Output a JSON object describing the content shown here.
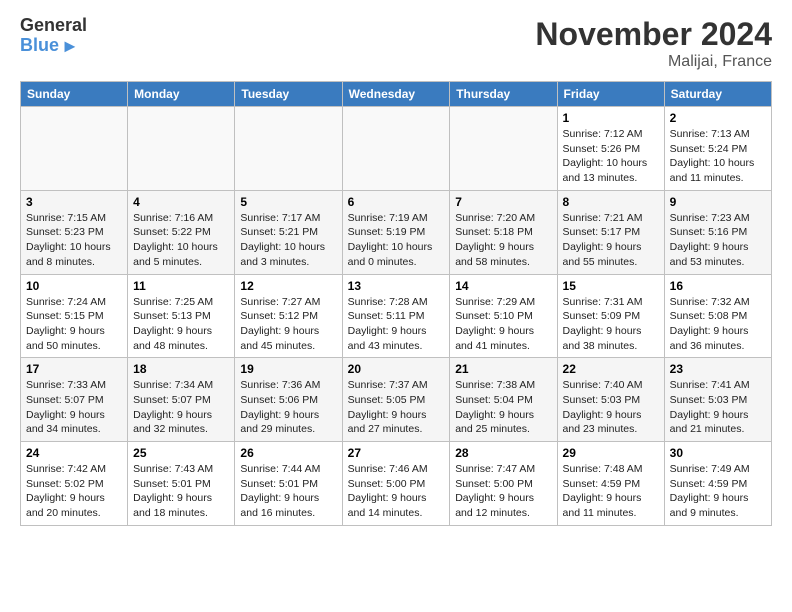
{
  "logo": {
    "general": "General",
    "blue": "Blue"
  },
  "title": "November 2024",
  "subtitle": "Malijai, France",
  "headers": [
    "Sunday",
    "Monday",
    "Tuesday",
    "Wednesday",
    "Thursday",
    "Friday",
    "Saturday"
  ],
  "weeks": [
    [
      {
        "day": "",
        "info": ""
      },
      {
        "day": "",
        "info": ""
      },
      {
        "day": "",
        "info": ""
      },
      {
        "day": "",
        "info": ""
      },
      {
        "day": "",
        "info": ""
      },
      {
        "day": "1",
        "info": "Sunrise: 7:12 AM\nSunset: 5:26 PM\nDaylight: 10 hours\nand 13 minutes."
      },
      {
        "day": "2",
        "info": "Sunrise: 7:13 AM\nSunset: 5:24 PM\nDaylight: 10 hours\nand 11 minutes."
      }
    ],
    [
      {
        "day": "3",
        "info": "Sunrise: 7:15 AM\nSunset: 5:23 PM\nDaylight: 10 hours\nand 8 minutes."
      },
      {
        "day": "4",
        "info": "Sunrise: 7:16 AM\nSunset: 5:22 PM\nDaylight: 10 hours\nand 5 minutes."
      },
      {
        "day": "5",
        "info": "Sunrise: 7:17 AM\nSunset: 5:21 PM\nDaylight: 10 hours\nand 3 minutes."
      },
      {
        "day": "6",
        "info": "Sunrise: 7:19 AM\nSunset: 5:19 PM\nDaylight: 10 hours\nand 0 minutes."
      },
      {
        "day": "7",
        "info": "Sunrise: 7:20 AM\nSunset: 5:18 PM\nDaylight: 9 hours\nand 58 minutes."
      },
      {
        "day": "8",
        "info": "Sunrise: 7:21 AM\nSunset: 5:17 PM\nDaylight: 9 hours\nand 55 minutes."
      },
      {
        "day": "9",
        "info": "Sunrise: 7:23 AM\nSunset: 5:16 PM\nDaylight: 9 hours\nand 53 minutes."
      }
    ],
    [
      {
        "day": "10",
        "info": "Sunrise: 7:24 AM\nSunset: 5:15 PM\nDaylight: 9 hours\nand 50 minutes."
      },
      {
        "day": "11",
        "info": "Sunrise: 7:25 AM\nSunset: 5:13 PM\nDaylight: 9 hours\nand 48 minutes."
      },
      {
        "day": "12",
        "info": "Sunrise: 7:27 AM\nSunset: 5:12 PM\nDaylight: 9 hours\nand 45 minutes."
      },
      {
        "day": "13",
        "info": "Sunrise: 7:28 AM\nSunset: 5:11 PM\nDaylight: 9 hours\nand 43 minutes."
      },
      {
        "day": "14",
        "info": "Sunrise: 7:29 AM\nSunset: 5:10 PM\nDaylight: 9 hours\nand 41 minutes."
      },
      {
        "day": "15",
        "info": "Sunrise: 7:31 AM\nSunset: 5:09 PM\nDaylight: 9 hours\nand 38 minutes."
      },
      {
        "day": "16",
        "info": "Sunrise: 7:32 AM\nSunset: 5:08 PM\nDaylight: 9 hours\nand 36 minutes."
      }
    ],
    [
      {
        "day": "17",
        "info": "Sunrise: 7:33 AM\nSunset: 5:07 PM\nDaylight: 9 hours\nand 34 minutes."
      },
      {
        "day": "18",
        "info": "Sunrise: 7:34 AM\nSunset: 5:07 PM\nDaylight: 9 hours\nand 32 minutes."
      },
      {
        "day": "19",
        "info": "Sunrise: 7:36 AM\nSunset: 5:06 PM\nDaylight: 9 hours\nand 29 minutes."
      },
      {
        "day": "20",
        "info": "Sunrise: 7:37 AM\nSunset: 5:05 PM\nDaylight: 9 hours\nand 27 minutes."
      },
      {
        "day": "21",
        "info": "Sunrise: 7:38 AM\nSunset: 5:04 PM\nDaylight: 9 hours\nand 25 minutes."
      },
      {
        "day": "22",
        "info": "Sunrise: 7:40 AM\nSunset: 5:03 PM\nDaylight: 9 hours\nand 23 minutes."
      },
      {
        "day": "23",
        "info": "Sunrise: 7:41 AM\nSunset: 5:03 PM\nDaylight: 9 hours\nand 21 minutes."
      }
    ],
    [
      {
        "day": "24",
        "info": "Sunrise: 7:42 AM\nSunset: 5:02 PM\nDaylight: 9 hours\nand 20 minutes."
      },
      {
        "day": "25",
        "info": "Sunrise: 7:43 AM\nSunset: 5:01 PM\nDaylight: 9 hours\nand 18 minutes."
      },
      {
        "day": "26",
        "info": "Sunrise: 7:44 AM\nSunset: 5:01 PM\nDaylight: 9 hours\nand 16 minutes."
      },
      {
        "day": "27",
        "info": "Sunrise: 7:46 AM\nSunset: 5:00 PM\nDaylight: 9 hours\nand 14 minutes."
      },
      {
        "day": "28",
        "info": "Sunrise: 7:47 AM\nSunset: 5:00 PM\nDaylight: 9 hours\nand 12 minutes."
      },
      {
        "day": "29",
        "info": "Sunrise: 7:48 AM\nSunset: 4:59 PM\nDaylight: 9 hours\nand 11 minutes."
      },
      {
        "day": "30",
        "info": "Sunrise: 7:49 AM\nSunset: 4:59 PM\nDaylight: 9 hours\nand 9 minutes."
      }
    ]
  ]
}
